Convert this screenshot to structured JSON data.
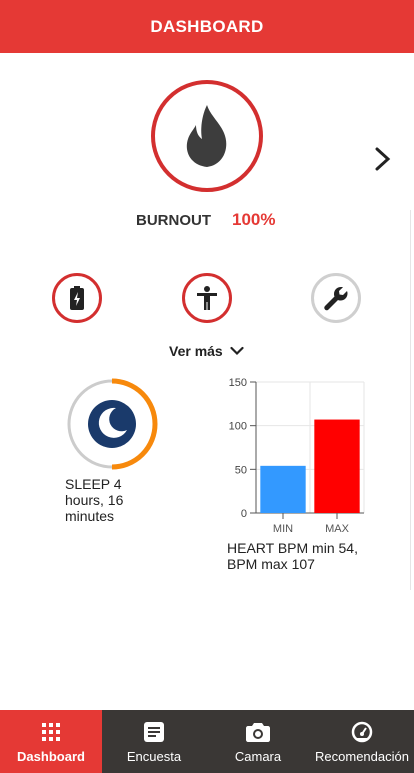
{
  "header": {
    "title": "DASHBOARD"
  },
  "burnout": {
    "icon": "flame-icon",
    "label": "BURNOUT",
    "value": "100%",
    "color": "#e53935"
  },
  "status_icons": [
    {
      "icon": "battery-icon",
      "state": "active"
    },
    {
      "icon": "person-icon",
      "state": "active"
    },
    {
      "icon": "wrench-icon",
      "state": "inactive"
    }
  ],
  "more": {
    "label": "Ver más",
    "icon": "chevron-down-icon"
  },
  "sleep": {
    "text": "SLEEP 4 hours, 16 minutes",
    "icon": "moon-icon"
  },
  "heart": {
    "text": "HEART BPM min 54, BPM max 107"
  },
  "chart_data": {
    "type": "bar",
    "categories": [
      "MIN",
      "MAX"
    ],
    "values": [
      54,
      107
    ],
    "colors": [
      "#3399ff",
      "#ff0000"
    ],
    "ylim": [
      0,
      150
    ],
    "yticks": [
      0,
      50,
      100,
      150
    ],
    "grid": true
  },
  "nav": {
    "items": [
      {
        "label": "Dashboard",
        "icon": "grid-icon",
        "active": true
      },
      {
        "label": "Encuesta",
        "icon": "document-icon",
        "active": false
      },
      {
        "label": "Camara",
        "icon": "camera-icon",
        "active": false
      },
      {
        "label": "Recomendación",
        "icon": "speedometer-icon",
        "active": false
      }
    ]
  },
  "colors": {
    "accent": "#e53935",
    "nav_bg": "#3a3735",
    "sleep_arc": "#f7890c",
    "moon": "#1a3a6b"
  }
}
